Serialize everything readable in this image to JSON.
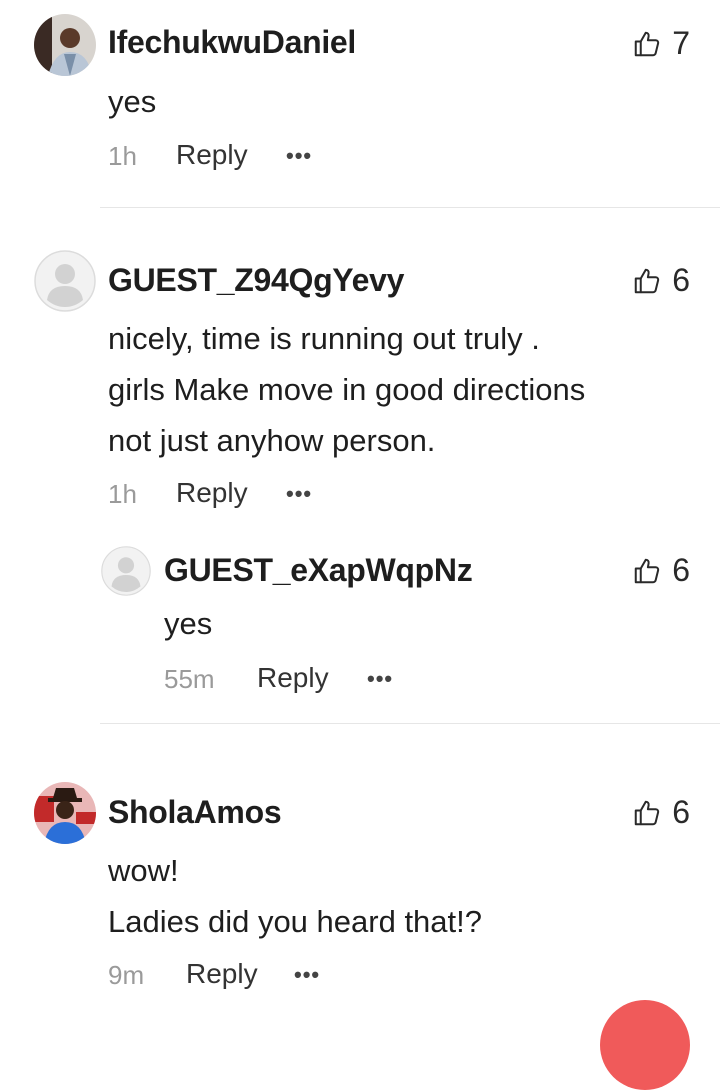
{
  "comments": [
    {
      "username": "IfechukwuDaniel",
      "avatar": "photo-avatar-man-suit",
      "body": [
        "yes"
      ],
      "time": "1h",
      "reply_label": "Reply",
      "more_label": "•••",
      "likes": "7"
    },
    {
      "username": "GUEST_Z94QgYevy",
      "avatar": "default-user-avatar",
      "body": [
        "nicely, time is running out truly .",
        "girls Make move in good directions",
        "not just anyhow person."
      ],
      "time": "1h",
      "reply_label": "Reply",
      "more_label": "•••",
      "likes": "6",
      "replies": [
        {
          "username": "GUEST_eXapWqpNz",
          "avatar": "default-user-avatar",
          "body": [
            "yes"
          ],
          "time": "55m",
          "reply_label": "Reply",
          "more_label": "•••",
          "likes": "6"
        }
      ]
    },
    {
      "username": "SholaAmos",
      "avatar": "photo-avatar-man-hat",
      "body": [
        "wow!",
        "Ladies did you heard that!?"
      ],
      "time": "9m",
      "reply_label": "Reply",
      "more_label": "•••",
      "likes": "6"
    }
  ],
  "colors": {
    "divider": "#e6e6e6",
    "meta": "#9a9a9a",
    "fab": "#f05a5a"
  },
  "icons": {
    "like": "thumbs-up-icon",
    "more": "more-dots-icon"
  }
}
